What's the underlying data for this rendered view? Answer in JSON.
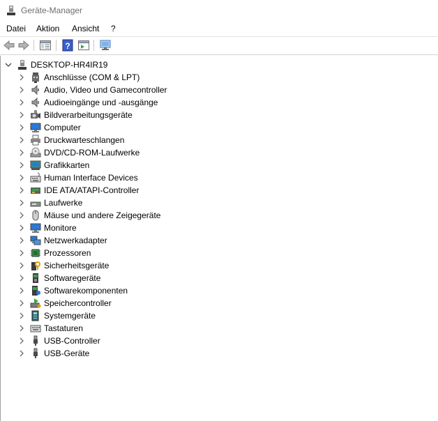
{
  "window": {
    "title": "Geräte-Manager"
  },
  "menu": {
    "items": [
      "Datei",
      "Aktion",
      "Ansicht",
      "?"
    ]
  },
  "tree": {
    "root": "DESKTOP-HR4IR19",
    "categories": [
      {
        "label": "Anschlüsse (COM & LPT)",
        "icon": "port-icon"
      },
      {
        "label": "Audio, Video und Gamecontroller",
        "icon": "speaker-icon"
      },
      {
        "label": "Audioeingänge und -ausgänge",
        "icon": "speaker-icon"
      },
      {
        "label": "Bildverarbeitungsgeräte",
        "icon": "camera-icon"
      },
      {
        "label": "Computer",
        "icon": "monitor-icon"
      },
      {
        "label": "Druckwarteschlangen",
        "icon": "printer-icon"
      },
      {
        "label": "DVD/CD-ROM-Laufwerke",
        "icon": "disc-drive-icon"
      },
      {
        "label": "Grafikkarten",
        "icon": "display-adapter-icon"
      },
      {
        "label": "Human Interface Devices",
        "icon": "hid-icon"
      },
      {
        "label": "IDE ATA/ATAPI-Controller",
        "icon": "ide-controller-icon"
      },
      {
        "label": "Laufwerke",
        "icon": "disk-drive-icon"
      },
      {
        "label": "Mäuse und andere Zeigegeräte",
        "icon": "mouse-icon"
      },
      {
        "label": "Monitore",
        "icon": "monitor-icon"
      },
      {
        "label": "Netzwerkadapter",
        "icon": "network-icon"
      },
      {
        "label": "Prozessoren",
        "icon": "processor-icon"
      },
      {
        "label": "Sicherheitsgeräte",
        "icon": "security-key-icon"
      },
      {
        "label": "Softwaregeräte",
        "icon": "software-device-icon"
      },
      {
        "label": "Softwarekomponenten",
        "icon": "software-component-icon"
      },
      {
        "label": "Speichercontroller",
        "icon": "storage-controller-icon"
      },
      {
        "label": "Systemgeräte",
        "icon": "system-device-icon"
      },
      {
        "label": "Tastaturen",
        "icon": "keyboard-icon"
      },
      {
        "label": "USB-Controller",
        "icon": "usb-icon"
      },
      {
        "label": "USB-Geräte",
        "icon": "usb-icon"
      }
    ]
  },
  "colors": {
    "accent": "#2b78d6",
    "icon_gray": "#555555",
    "chevron": "#6b6b6b"
  }
}
